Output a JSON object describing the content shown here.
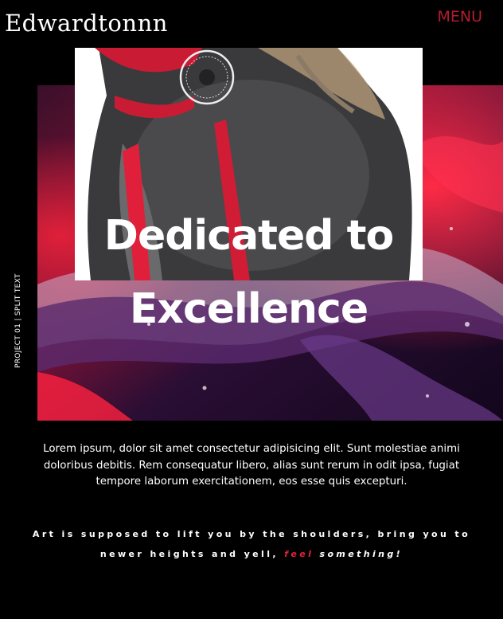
{
  "header": {
    "logo": "Edwardtonnn",
    "menu_label": "MENU"
  },
  "colors": {
    "accent": "#b51c2c",
    "highlight": "#e0223a",
    "background": "#000000"
  },
  "sidebar": {
    "vertical_label": "PROJECT 01 | SPLIT TEXT"
  },
  "hero": {
    "title_line1": "Dedicated to",
    "title_line2": "Excellence"
  },
  "main": {
    "paragraph": "Lorem ipsum, dolor sit amet consectetur adipisicing elit. Sunt molestiae animi doloribus debitis. Rem consequatur libero, alias sunt rerum in odit ipsa, fugiat tempore laborum exercitationem, eos esse quis excepturi."
  },
  "quote": {
    "part1": "Art is supposed to lift you by the shoulders, bring you to newer heights and yell, ",
    "feel": "feel",
    "part2": " something!"
  }
}
